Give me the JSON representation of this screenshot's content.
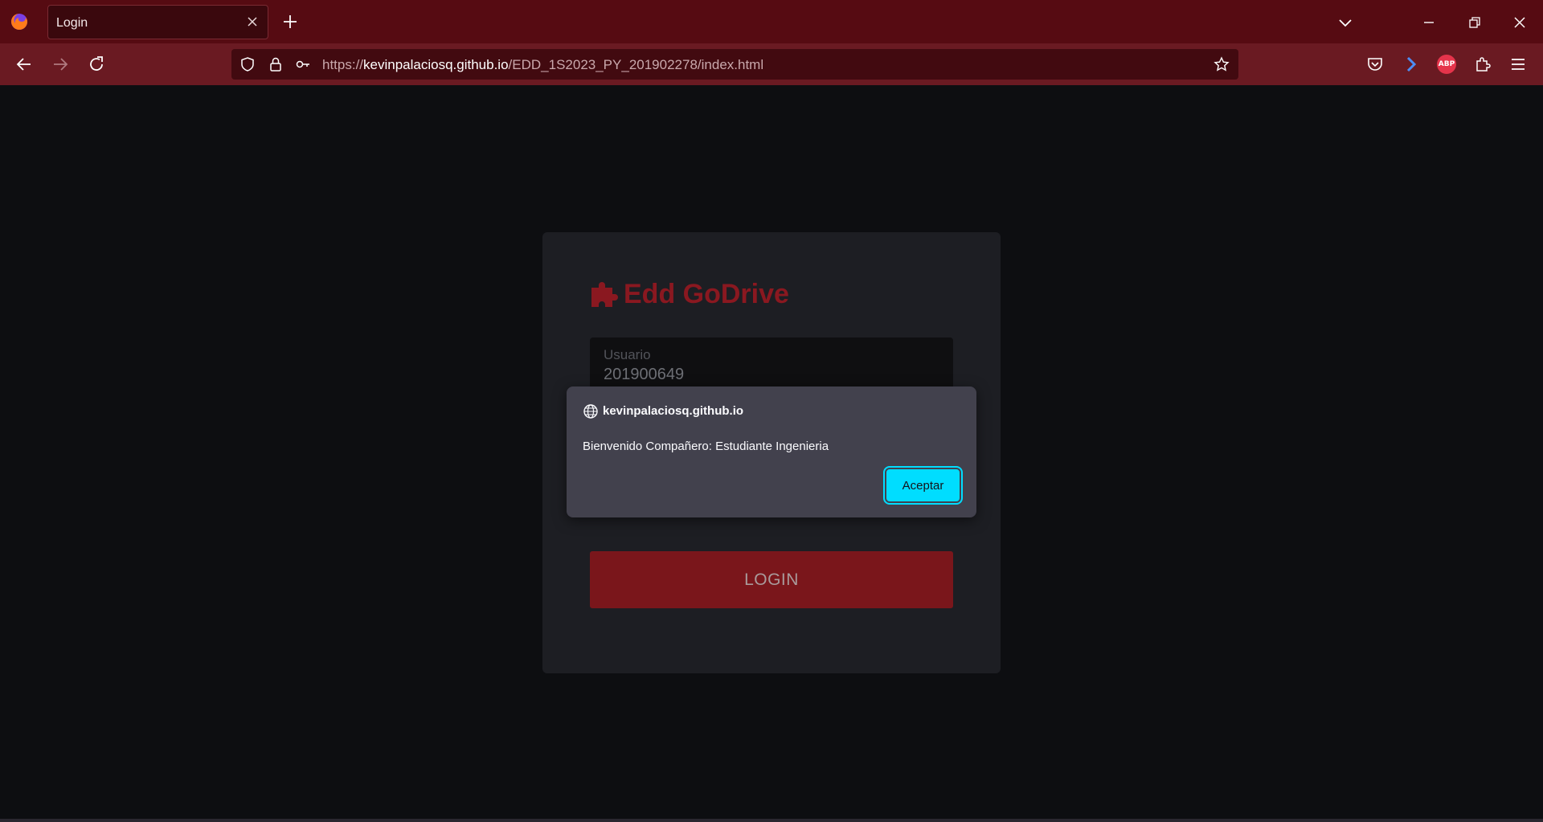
{
  "browser": {
    "tab": {
      "title": "Login"
    },
    "url": {
      "prefix": "https://",
      "host": "kevinpalaciosq.github.io",
      "path": "/EDD_1S2023_PY_201902278/index.html"
    },
    "extensions": {
      "abp_label": "ABP"
    }
  },
  "login_card": {
    "brand": "Edd GoDrive",
    "username_label": "Usuario",
    "username_value": "201900649",
    "login_button": "LOGIN",
    "colors": {
      "brand": "#8a1820",
      "button": "#7a161b"
    }
  },
  "alert": {
    "origin": "kevinpalaciosq.github.io",
    "message": "Bienvenido Compañero: Estudiante Ingenieria",
    "accept_button": "Aceptar",
    "colors": {
      "accent": "#00ddff"
    }
  }
}
